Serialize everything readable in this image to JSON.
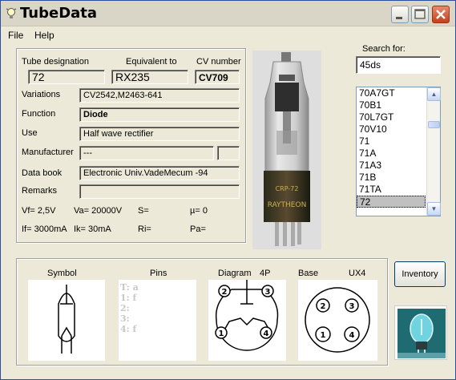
{
  "window": {
    "title": "TubeData"
  },
  "menu": {
    "file": "File",
    "help": "Help"
  },
  "tube": {
    "designation_label": "Tube designation",
    "designation": "72",
    "equivalent_label": "Equivalent to",
    "equivalent": "RX235",
    "cv_label": "CV number",
    "cv": "CV709",
    "variations_label": "Variations",
    "variations": "CV2542,M2463-641",
    "function_label": "Function",
    "function": "Diode",
    "use_label": "Use",
    "use": "Half wave rectifier",
    "manufacturer_label": "Manufacturer",
    "manufacturer": "---",
    "databook_label": "Data book",
    "databook": "Electronic Univ.VadeMecum -94",
    "remarks_label": "Remarks",
    "remarks": "",
    "vf": "Vf= 2,5V",
    "va": "Va= 20000V",
    "s": "S=",
    "mu": "µ=    0",
    "if": "If= 3000mA",
    "ik": "Ik=   30mA",
    "ri": "Ri=",
    "pa": "Pa="
  },
  "photo": {
    "glass_print_1": "CRP-72",
    "glass_print_2": "RAYTHEON"
  },
  "search": {
    "label": "Search for:",
    "value": "45ds",
    "items": [
      "70A7GT",
      "70B1",
      "70L7GT",
      "70V10",
      "71",
      "71A",
      "71A3",
      "71B",
      "71TA",
      "72"
    ],
    "selected": "72"
  },
  "bottom": {
    "symbol_label": "Symbol",
    "pins_label": "Pins",
    "diagram_label": "Diagram",
    "diagram_pins": "4P",
    "base_label": "Base",
    "base_type": "UX4",
    "pins": [
      "T: a",
      "1: f",
      "2:",
      "3:",
      "4: f"
    ],
    "diag_numbers": [
      "2",
      "3",
      "1",
      "4"
    ],
    "base_numbers": [
      "2",
      "3",
      "1",
      "4"
    ]
  },
  "buttons": {
    "inventory": "Inventory"
  }
}
